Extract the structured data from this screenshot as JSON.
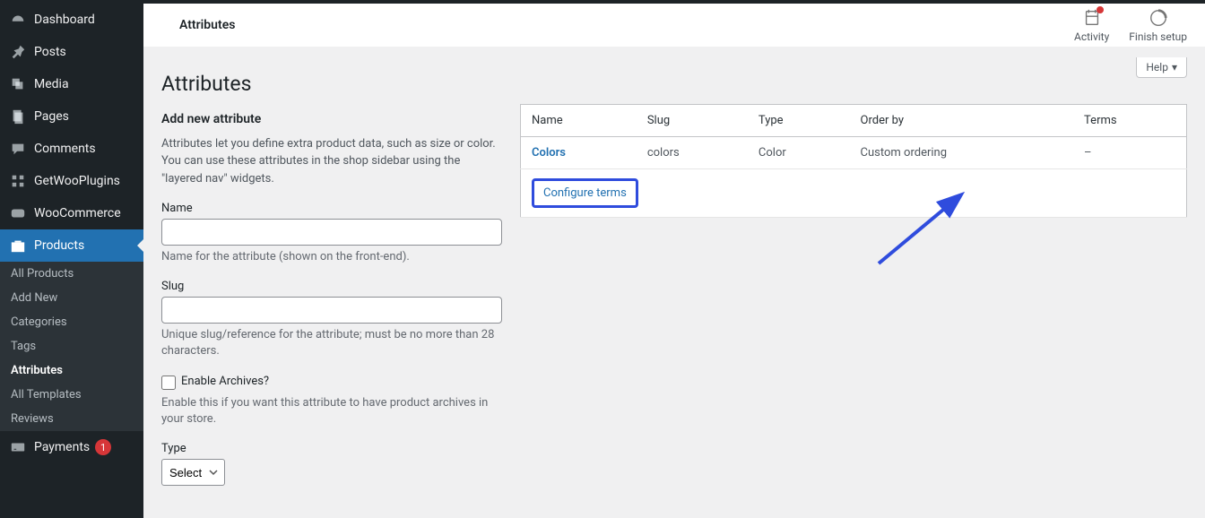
{
  "sidebar": {
    "items": [
      {
        "label": "Dashboard",
        "icon": "dashboard"
      },
      {
        "label": "Posts",
        "icon": "pin"
      },
      {
        "label": "Media",
        "icon": "media"
      },
      {
        "label": "Pages",
        "icon": "pages"
      },
      {
        "label": "Comments",
        "icon": "comments"
      },
      {
        "label": "GetWooPlugins",
        "icon": "plugins"
      },
      {
        "label": "WooCommerce",
        "icon": "woo"
      },
      {
        "label": "Products",
        "icon": "products"
      },
      {
        "label": "Payments",
        "icon": "payments",
        "badge": "1"
      }
    ],
    "submenu": [
      {
        "label": "All Products"
      },
      {
        "label": "Add New"
      },
      {
        "label": "Categories"
      },
      {
        "label": "Tags"
      },
      {
        "label": "Attributes"
      },
      {
        "label": "All Templates"
      },
      {
        "label": "Reviews"
      }
    ]
  },
  "header": {
    "title": "Attributes",
    "activity": "Activity",
    "finish_setup": "Finish setup",
    "help": "Help"
  },
  "page": {
    "title": "Attributes"
  },
  "form": {
    "section_title": "Add new attribute",
    "description": "Attributes let you define extra product data, such as size or color. You can use these attributes in the shop sidebar using the \"layered nav\" widgets.",
    "name_label": "Name",
    "name_help": "Name for the attribute (shown on the front-end).",
    "slug_label": "Slug",
    "slug_help": "Unique slug/reference for the attribute; must be no more than 28 characters.",
    "archives_label": "Enable Archives?",
    "archives_help": "Enable this if you want this attribute to have product archives in your store.",
    "type_label": "Type",
    "type_selected": "Select"
  },
  "table": {
    "headers": {
      "name": "Name",
      "slug": "Slug",
      "type": "Type",
      "order_by": "Order by",
      "terms": "Terms"
    },
    "rows": [
      {
        "name": "Colors",
        "slug": "colors",
        "type": "Color",
        "order_by": "Custom ordering",
        "terms": "–"
      }
    ],
    "configure_terms": "Configure terms"
  }
}
